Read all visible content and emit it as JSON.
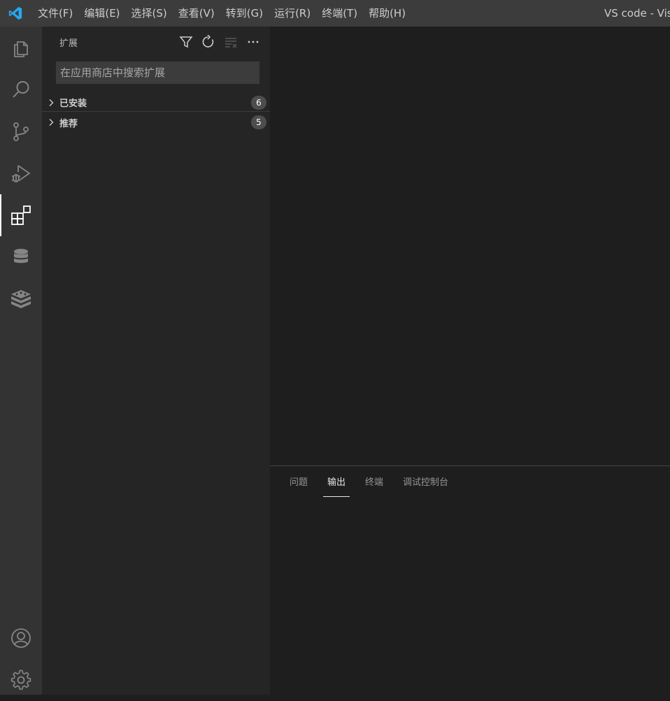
{
  "titlebar": {
    "menu": [
      "文件(F)",
      "编辑(E)",
      "选择(S)",
      "查看(V)",
      "转到(G)",
      "运行(R)",
      "终端(T)",
      "帮助(H)"
    ],
    "window_title": "VS code - Visu"
  },
  "activitybar": {
    "items": [
      {
        "icon": "explorer-icon"
      },
      {
        "icon": "search-icon"
      },
      {
        "icon": "source-control-icon"
      },
      {
        "icon": "run-debug-icon"
      },
      {
        "icon": "extensions-icon",
        "active": true
      },
      {
        "icon": "database-icon"
      },
      {
        "icon": "stack-icon"
      }
    ],
    "bottom": [
      {
        "icon": "account-icon"
      },
      {
        "icon": "settings-gear-icon"
      }
    ]
  },
  "sidebar": {
    "title": "扩展",
    "actions": [
      "filter-icon",
      "refresh-icon",
      "clear-list-icon",
      "more-icon"
    ],
    "search": {
      "placeholder": "在应用商店中搜索扩展",
      "value": ""
    },
    "sections": [
      {
        "label": "已安装",
        "count": "6"
      },
      {
        "label": "推荐",
        "count": "5"
      }
    ]
  },
  "panel": {
    "tabs": [
      {
        "label": "问题"
      },
      {
        "label": "输出",
        "active": true
      },
      {
        "label": "终端"
      },
      {
        "label": "调试控制台"
      }
    ]
  },
  "colors": {
    "titlebar_bg": "#3c3c3c",
    "activitybar_bg": "#333333",
    "sidebar_bg": "#252526",
    "editor_bg": "#1e1e1e",
    "accent_logo": "#23a9f2"
  }
}
